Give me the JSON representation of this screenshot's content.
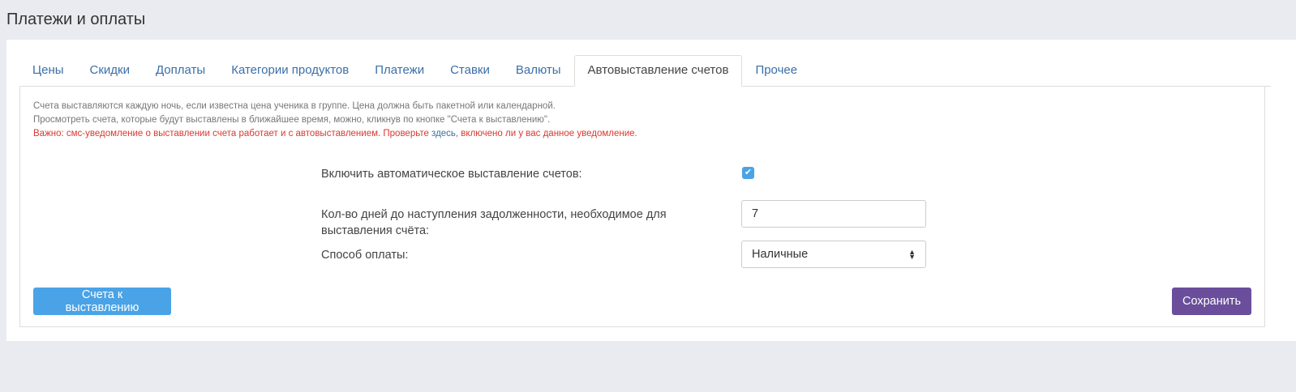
{
  "page": {
    "title": "Платежи и оплаты"
  },
  "tabs": [
    {
      "label": "Цены",
      "active": false
    },
    {
      "label": "Скидки",
      "active": false
    },
    {
      "label": "Доплаты",
      "active": false
    },
    {
      "label": "Категории продуктов",
      "active": false
    },
    {
      "label": "Платежи",
      "active": false
    },
    {
      "label": "Ставки",
      "active": false
    },
    {
      "label": "Валюты",
      "active": false
    },
    {
      "label": "Автовыставление счетов",
      "active": true
    },
    {
      "label": "Прочее",
      "active": false
    }
  ],
  "info": {
    "line1": "Счета выставляются каждую ночь, если известна цена ученика в группе. Цена должна быть пакетной или календарной.",
    "line2": "Просмотреть счета, которые будут выставлены в ближайшее время, можно, кликнув по кнопке \"Счета к выставлению\".",
    "warn_before": "Важно: смс-уведомление о выставлении счета работает и с автовыставлением. Проверьте ",
    "warn_link": "здесь",
    "warn_after": ", включено ли у вас данное уведомление."
  },
  "form": {
    "auto_invoice_label": "Включить автоматическое выставление счетов:",
    "auto_invoice_checked": true,
    "days_label_line1": "Кол-во дней до наступления задолженности, необходимое для",
    "days_label_line2": "выставления счёта:",
    "days_value": "7",
    "payment_method_label": "Способ оплаты:",
    "payment_method_value": "Наличные"
  },
  "buttons": {
    "pending_invoices": "Счета к выставлению",
    "save": "Сохранить"
  },
  "colors": {
    "accent_blue": "#4aa3e6",
    "save_purple": "#6a4e9b",
    "warning_red": "#d9382f",
    "link_blue": "#3a6fa8"
  }
}
